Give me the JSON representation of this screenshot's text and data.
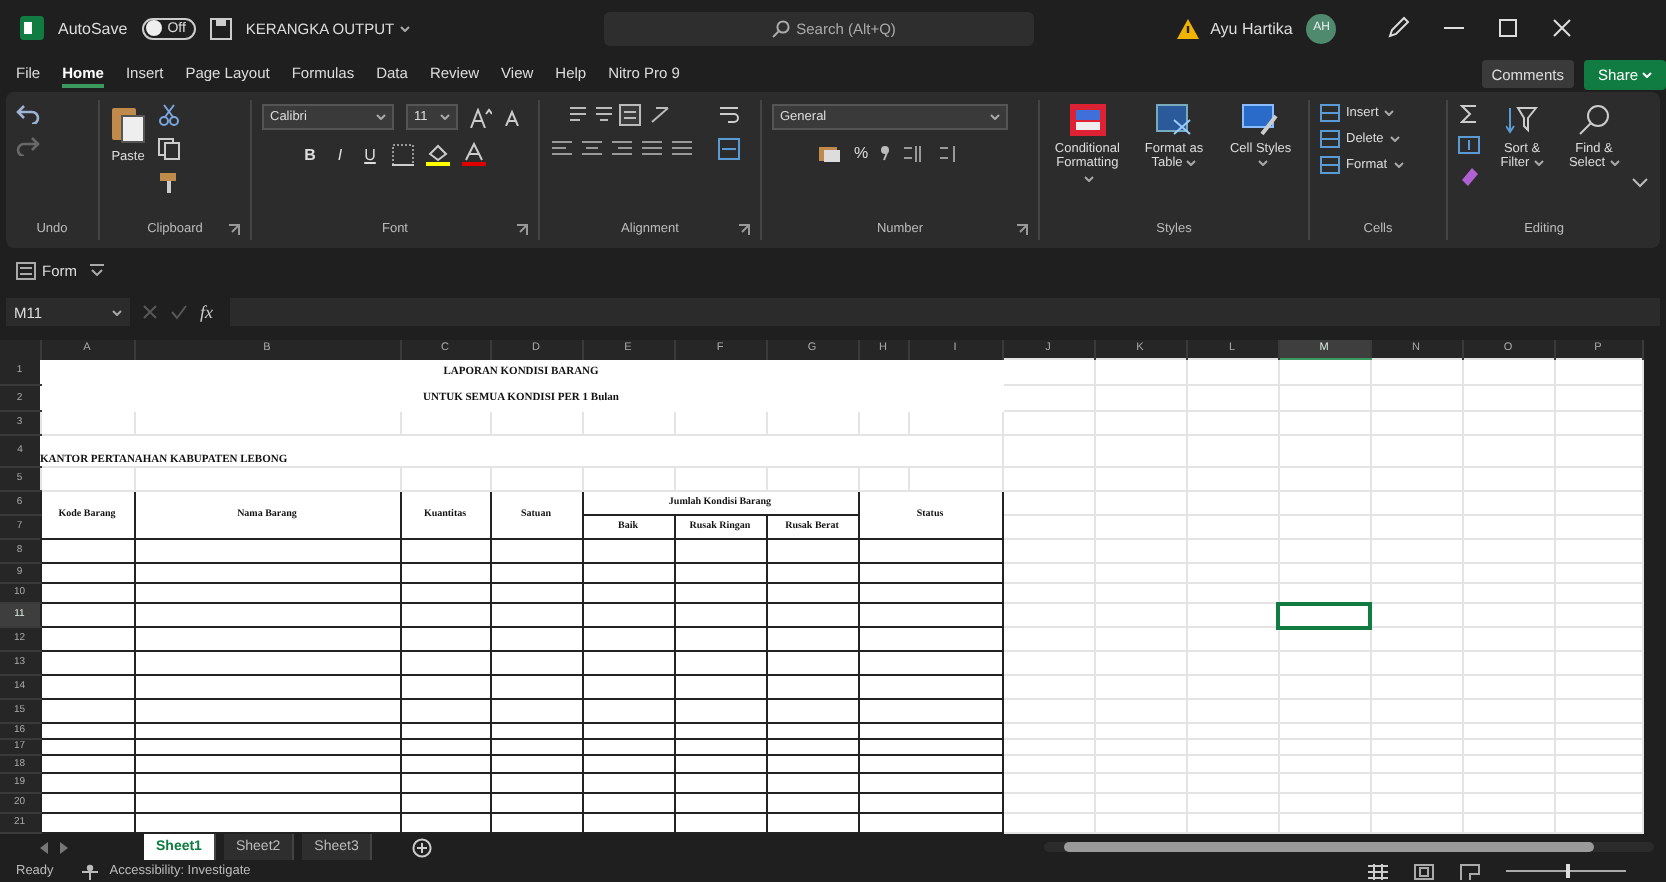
{
  "window": {
    "autosave": {
      "label": "AutoSave",
      "on": false,
      "state_text": "Off"
    },
    "title": "KERANGKA OUTPUT",
    "search": {
      "placeholder": "Search (Alt+Q)"
    },
    "user": {
      "name": "Ayu Hartika",
      "initials": "AH"
    }
  },
  "ribbon_tabs": [
    {
      "label": "File",
      "selected": false
    },
    {
      "label": "Home",
      "selected": true
    },
    {
      "label": "Insert",
      "selected": false
    },
    {
      "label": "Page Layout",
      "selected": false
    },
    {
      "label": "Formulas",
      "selected": false
    },
    {
      "label": "Data",
      "selected": false
    },
    {
      "label": "Review",
      "selected": false
    },
    {
      "label": "View",
      "selected": false
    },
    {
      "label": "Help",
      "selected": false
    },
    {
      "label": "Nitro Pro 9",
      "selected": false
    }
  ],
  "comments_button": "Comments",
  "share_button": "Share",
  "ribbon_groups": [
    {
      "kind": "undo",
      "label": "Undo"
    },
    {
      "kind": "clipboard",
      "label": "Clipboard",
      "paste": "Paste"
    },
    {
      "kind": "font",
      "label": "Font",
      "font": "Calibri",
      "size": "11",
      "styles": [
        "B",
        "I",
        "U"
      ]
    },
    {
      "kind": "alignment",
      "label": "Alignment"
    },
    {
      "kind": "number",
      "label": "Number",
      "format": "General",
      "percent": "%"
    },
    {
      "kind": "styles",
      "label": "Styles",
      "buttons": [
        "Conditional Formatting",
        "Format as Table",
        "Cell Styles"
      ]
    },
    {
      "kind": "cells",
      "label": "Cells",
      "buttons": [
        "Insert",
        "Delete",
        "Format"
      ]
    },
    {
      "kind": "editing",
      "label": "Editing",
      "buttons": [
        "Sort & Filter",
        "Find & Select"
      ]
    }
  ],
  "quick_access": {
    "form_button": "Form"
  },
  "formula_bar": {
    "name_box": "M11",
    "fx": "fx"
  },
  "sheet": {
    "columns": [
      {
        "label": "A",
        "selected": false
      },
      {
        "label": "B",
        "selected": false
      },
      {
        "label": "C",
        "selected": false
      },
      {
        "label": "D",
        "selected": false
      },
      {
        "label": "E",
        "selected": false
      },
      {
        "label": "F",
        "selected": false
      },
      {
        "label": "G",
        "selected": false
      },
      {
        "label": "H",
        "selected": false
      },
      {
        "label": "I",
        "selected": false
      },
      {
        "label": "J",
        "selected": false
      },
      {
        "label": "K",
        "selected": false
      },
      {
        "label": "L",
        "selected": false
      },
      {
        "label": "M",
        "selected": true
      },
      {
        "label": "N",
        "selected": false
      },
      {
        "label": "O",
        "selected": false
      },
      {
        "label": "P",
        "selected": false
      }
    ],
    "rows": [
      {
        "label": "1",
        "selected": false
      },
      {
        "label": "2",
        "selected": false
      },
      {
        "label": "3",
        "selected": false
      },
      {
        "label": "4",
        "selected": false
      },
      {
        "label": "5",
        "selected": false
      },
      {
        "label": "6",
        "selected": false
      },
      {
        "label": "7",
        "selected": false
      },
      {
        "label": "8",
        "selected": false
      },
      {
        "label": "9",
        "selected": false
      },
      {
        "label": "10",
        "selected": false
      },
      {
        "label": "11",
        "selected": true
      },
      {
        "label": "12",
        "selected": false
      },
      {
        "label": "13",
        "selected": false
      },
      {
        "label": "14",
        "selected": false
      },
      {
        "label": "15",
        "selected": false
      },
      {
        "label": "16",
        "selected": false
      },
      {
        "label": "17",
        "selected": false
      },
      {
        "label": "18",
        "selected": false
      },
      {
        "label": "19",
        "selected": false
      },
      {
        "label": "20",
        "selected": false
      },
      {
        "label": "21",
        "selected": false
      }
    ],
    "title": "LAPORAN KONDISI BARANG",
    "subtitle": "UNTUK SEMUA KONDISI PER 1 Bulan",
    "office": "KANTOR PERTANAHAN KABUPATEN LEBONG",
    "header_columns": [
      "Kode Barang",
      "Nama Barang",
      "Kuantitas",
      "Satuan"
    ],
    "group_header": {
      "label": "Jumlah Kondisi Barang",
      "sub": [
        "Baik",
        "Rusak Ringan",
        "Rusak Berat"
      ]
    },
    "status_header": "Status"
  },
  "sheet_tabs": [
    {
      "label": "Sheet1",
      "selected": true
    },
    {
      "label": "Sheet2",
      "selected": false
    },
    {
      "label": "Sheet3",
      "selected": false
    }
  ],
  "status_bar": {
    "ready": "Ready",
    "accessibility": "Accessibility: Investigate",
    "zoom_slider": {
      "level": 0.5
    }
  }
}
